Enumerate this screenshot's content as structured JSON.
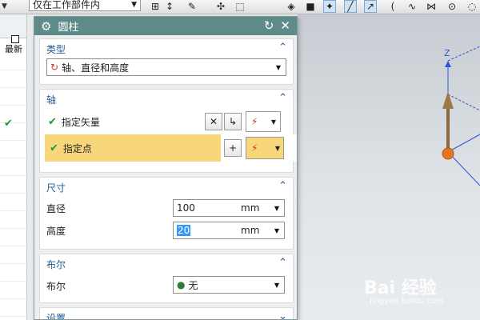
{
  "toolbar": {
    "filter_value": "仅在工作部件内",
    "icons": [
      "sketch-icon",
      "box-icon",
      "snap-point-icon",
      "snap-line-icon",
      "snap-node-icon",
      "arc-icon",
      "curve-icon",
      "intersect-icon",
      "circle-center-icon"
    ]
  },
  "navigator": {
    "column_label": "最新",
    "checked_row": true
  },
  "dialog": {
    "title": "圆柱",
    "type_group": {
      "label": "类型",
      "selected": "轴、直径和高度"
    },
    "axis_group": {
      "label": "轴",
      "vector_label": "指定矢量",
      "point_label": "指定点"
    },
    "dimension_group": {
      "label": "尺寸",
      "diameter_label": "直径",
      "diameter_value": "100",
      "diameter_unit": "mm",
      "height_label": "高度",
      "height_value": "20",
      "height_unit": "mm"
    },
    "boolean_group": {
      "label": "布尔",
      "field_label": "布尔",
      "value": "无"
    },
    "settings_group": {
      "label": "设置"
    }
  },
  "viewport": {
    "axis_label": "Z"
  },
  "watermark": {
    "brand": "Bai 经验",
    "url": "jingyan.baidu.com"
  },
  "colors": {
    "title_bar": "#5e8a8a",
    "group_header": "#1f5d99",
    "highlight_row": "#f8d77a",
    "check": "#1d9a32",
    "selection": "#3399ff"
  }
}
